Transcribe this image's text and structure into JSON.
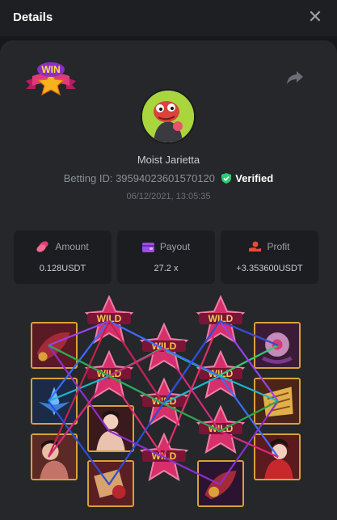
{
  "header": {
    "title": "Details"
  },
  "user": {
    "name": "Moist Jarietta"
  },
  "bet": {
    "id_label": "Betting ID: ",
    "id_value": "39594023601570120",
    "verified": "Verified",
    "datetime": "06/12/2021, 13:05:35"
  },
  "stats": {
    "amount": {
      "label": "Amount",
      "value": "0.128USDT"
    },
    "payout": {
      "label": "Payout",
      "value": "27.2 x"
    },
    "profit": {
      "label": "Profit",
      "value": "+3.353600USDT"
    }
  },
  "badge": {
    "text": "WIN"
  },
  "wild_text": "WILD",
  "icons": {
    "close": "close-icon",
    "share": "share-icon",
    "win_badge": "win-badge-icon",
    "verified": "shield-check-icon",
    "amount": "coins-icon",
    "payout": "wallet-icon",
    "profit": "hand-coin-icon"
  },
  "colors": {
    "background": "#16181b",
    "card": "#25272a",
    "stat_box": "#1b1d20",
    "verified_green": "#2ecc71",
    "symbol_border": "#d9a13a",
    "wild_pink": "#d6306b"
  }
}
